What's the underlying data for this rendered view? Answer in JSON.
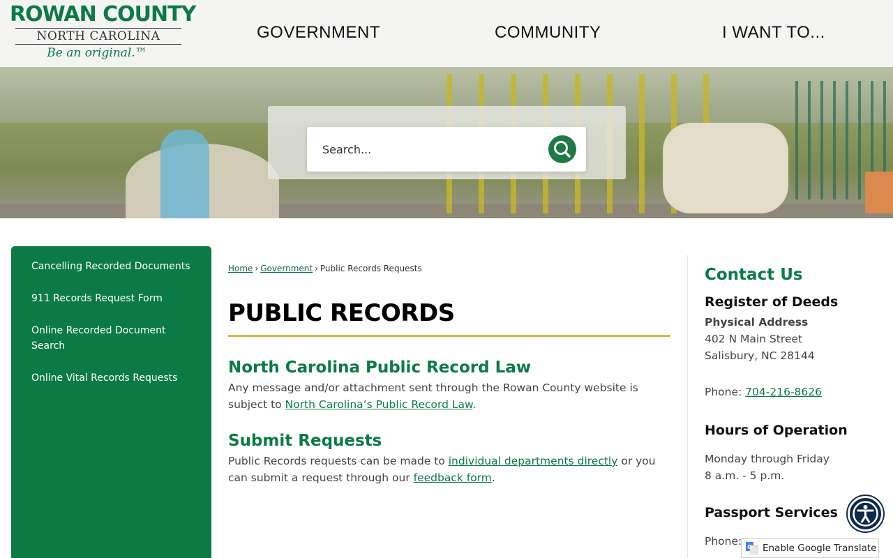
{
  "header": {
    "logo": {
      "line1": "ROWAN COUNTY",
      "line2": "NORTH CAROLINA",
      "tagline": "Be an original.™"
    },
    "nav": [
      {
        "label": "GOVERNMENT"
      },
      {
        "label": "COMMUNITY"
      },
      {
        "label": "I WANT TO..."
      }
    ]
  },
  "search": {
    "placeholder": "Search..."
  },
  "sidebar": {
    "items": [
      {
        "label": "Cancelling Recorded Documents"
      },
      {
        "label": "911 Records Request Form"
      },
      {
        "label": "Online Recorded Document Search"
      },
      {
        "label": "Online Vital Records Requests"
      }
    ]
  },
  "breadcrumb": {
    "home": "Home",
    "government": "Government",
    "current": "Public Records Requests",
    "separator": "›"
  },
  "main": {
    "title": "PUBLIC RECORDS",
    "sections": [
      {
        "heading": "North Carolina Public Record Law",
        "text_before": "Any message and/or attachment sent through the Rowan County website is subject to ",
        "link": "North Carolina’s Public Record Law",
        "text_after": "."
      },
      {
        "heading": "Submit Requests",
        "text_before": "Public Records requests can be made to ",
        "link1": "individual departments directly",
        "text_middle": " or you can submit a request through our ",
        "link2": "feedback form",
        "text_after": "."
      }
    ]
  },
  "contact": {
    "title": "Contact Us",
    "department": "Register of Deeds",
    "address_label": "Physical Address",
    "address_line1": "402 N Main Street",
    "address_line2": "Salisbury, NC 28144",
    "phone_label": "Phone: ",
    "phone": "704-216-8626",
    "hours_title": "Hours of Operation",
    "hours_days": "Monday through Friday",
    "hours_time": "8 a.m. - 5 p.m.",
    "passport_title": "Passport Services",
    "passport_phone_label": "Phone:"
  },
  "translate": {
    "label": "Enable Google Translate"
  },
  "colors": {
    "brand_green": "#0b7a45",
    "accent_gold": "#d6b84a",
    "a11y_navy": "#0e2a4a"
  },
  "icons": {
    "search": "search-icon",
    "accessibility": "accessibility-icon",
    "google_translate": "google-translate-icon"
  }
}
